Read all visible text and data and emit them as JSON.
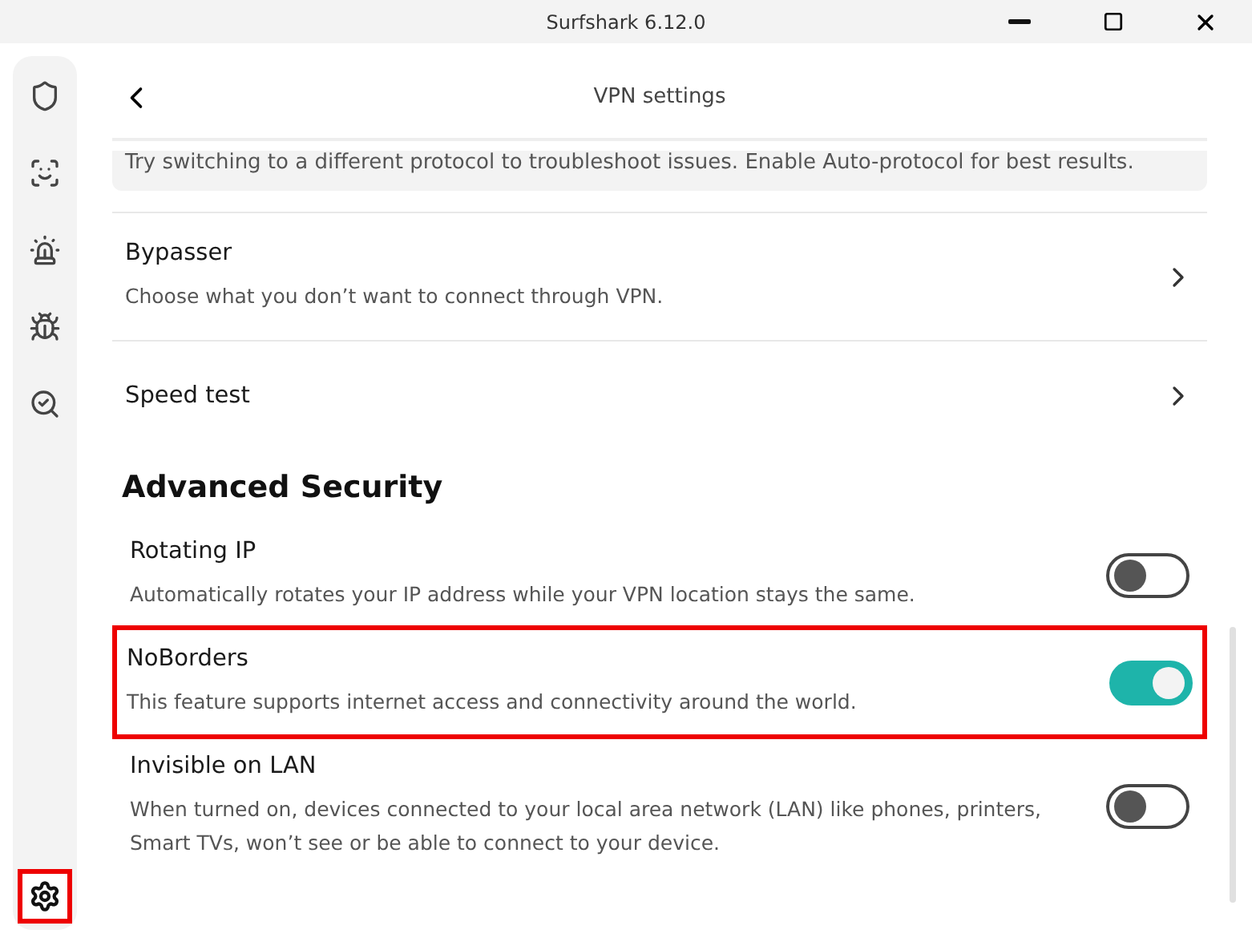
{
  "window": {
    "title": "Surfshark 6.12.0"
  },
  "sidebar": {
    "items": [
      {
        "kind": "shield",
        "selected": false,
        "highlighted": false
      },
      {
        "kind": "face",
        "selected": false,
        "highlighted": false
      },
      {
        "kind": "alert",
        "selected": false,
        "highlighted": false
      },
      {
        "kind": "bug",
        "selected": false,
        "highlighted": false
      },
      {
        "kind": "search",
        "selected": false,
        "highlighted": false
      }
    ],
    "bottom": {
      "kind": "settings",
      "selected": true,
      "highlighted": true
    }
  },
  "header": {
    "title": "VPN settings"
  },
  "notice": "Try switching to a different protocol to troubleshoot issues. Enable Auto-protocol for best results.",
  "links": [
    {
      "title": "Bypasser",
      "description": "Choose what you don’t want to connect through VPN."
    },
    {
      "title": "Speed test"
    }
  ],
  "section": {
    "title": "Advanced Security"
  },
  "toggles": [
    {
      "title": "Rotating IP",
      "description": "Automatically rotates your IP address while your VPN location stays the same.",
      "on": false,
      "highlighted": false
    },
    {
      "title": "NoBorders",
      "description": "This feature supports internet access and connectivity around the world.",
      "on": true,
      "highlighted": true
    },
    {
      "title": "Invisible on LAN",
      "description": "When turned on, devices connected to your local area network (LAN) like phones, printers, Smart TVs, won’t see or be able to connect to your device.",
      "on": false,
      "highlighted": false
    }
  ]
}
